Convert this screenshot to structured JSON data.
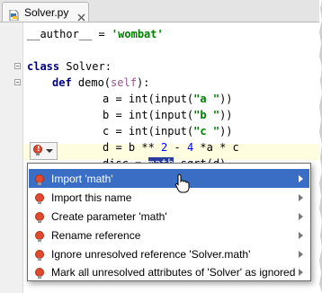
{
  "tab": {
    "title": "Solver.py",
    "icon": "python-file-icon",
    "close": "close-icon"
  },
  "code": {
    "author_prefix": "__author__ = ",
    "author_value": "'wombat'",
    "class_kw": "class",
    "class_name": " Solver:",
    "def_kw": "def",
    "def_rest_a": " demo(",
    "def_self": "self",
    "def_rest_b": "):",
    "line_a_1": "a = ",
    "line_a_2": "int(input(",
    "line_a_str": "\"a \"",
    "line_a_3": "))",
    "line_b_1": "b = ",
    "line_b_2": "int(input(",
    "line_b_str": "\"b \"",
    "line_b_3": "))",
    "line_c_1": "c = ",
    "line_c_2": "int(input(",
    "line_c_str": "\"c \"",
    "line_c_3": "))",
    "line_d_1": "d = b ** ",
    "line_d_n1": "2",
    "line_d_2": " - ",
    "line_d_n2": "4",
    "line_d_3": " *a * c",
    "line_disc_1": "disc = ",
    "line_disc_sel": "math",
    "line_disc_2": ".sqrt(d)"
  },
  "intention_menu": {
    "items": [
      {
        "label": "Import 'math'",
        "active": true
      },
      {
        "label": "Import this name",
        "active": false
      },
      {
        "label": "Create parameter 'math'",
        "active": false
      },
      {
        "label": "Rename reference",
        "active": false
      },
      {
        "label": "Ignore unresolved reference 'Solver.math'",
        "active": false
      },
      {
        "label": "Mark all unresolved attributes of 'Solver' as ignored",
        "active": false
      }
    ]
  },
  "colors": {
    "keyword": "#000080",
    "string": "#008000",
    "number": "#0000ff",
    "selection": "#2a3d9e",
    "menu_active": "#3a6ec4",
    "bulb": "#e24a2f"
  }
}
